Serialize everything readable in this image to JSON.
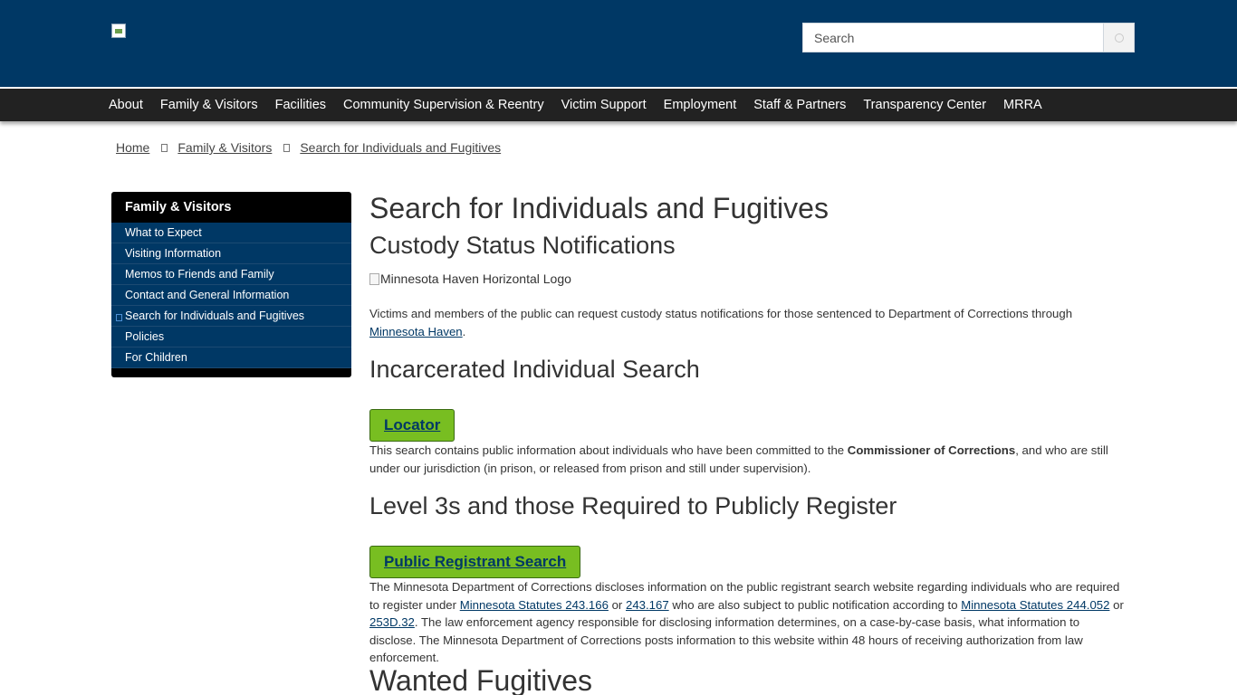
{
  "header": {
    "search": {
      "placeholder": "Search",
      "value": ""
    }
  },
  "nav": {
    "items": [
      "About",
      "Family & Visitors",
      "Facilities",
      "Community Supervision & Reentry",
      "Victim Support",
      "Employment",
      "Staff & Partners",
      "Transparency Center",
      "MRRA"
    ]
  },
  "breadcrumb": {
    "items": [
      "Home",
      "Family & Visitors",
      "Search for Individuals and Fugitives"
    ]
  },
  "sidebar": {
    "title": "Family & Visitors",
    "items": [
      "What to Expect",
      "Visiting Information",
      "Memos to Friends and Family",
      "Contact and General Information",
      "Search for Individuals and Fugitives",
      "Policies",
      "For Children"
    ],
    "active_index": 4
  },
  "main": {
    "title": "Search for Individuals and Fugitives",
    "custody": {
      "heading": "Custody Status Notifications",
      "logo_alt": "Minnesota Haven Horizontal Logo",
      "text_before": "Victims and members of the public can request custody status notifications for those sentenced to Department of Corrections through ",
      "link": "Minnesota Haven",
      "text_after": "."
    },
    "incarcerated": {
      "heading": "Incarcerated Individual Search",
      "button": "Locator",
      "text_before": "This search contains public information about individuals who have been committed to the ",
      "bold": "Commissioner of Corrections",
      "text_after": ", and who are still under our jurisdiction (in prison, or released from prison and still under supervision)."
    },
    "level3": {
      "heading": "Level 3s and those Required to Publicly Register",
      "button": "Public Registrant Search",
      "t1": "The Minnesota Department of Corrections discloses information on the public registrant search website regarding individuals who are required to register under ",
      "link1": "Minnesota Statutes 243.166",
      "t2": " or ",
      "link2": "243.167",
      "t3": " who are also subject to public notification according to ",
      "link3": "Minnesota Statutes 244.052",
      "t4": " or ",
      "link4": "253D.32",
      "t5": ". The law enforcement agency responsible for disclosing information determines, on a case-by-case basis, what information to disclose. The Minnesota Department of Corrections posts information to this website within 48 hours of receiving authorization from law enforcement."
    },
    "wanted": {
      "heading": "Wanted Fugitives"
    }
  },
  "colors": {
    "header_blue": "#003865",
    "nav_dark": "#222222",
    "button_green": "#78be21"
  }
}
